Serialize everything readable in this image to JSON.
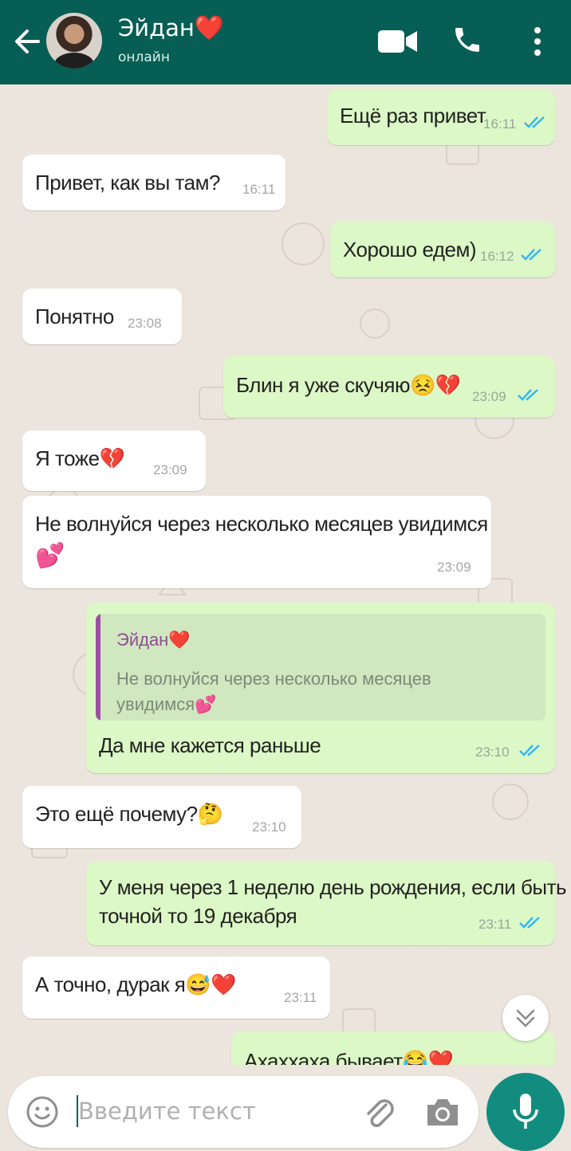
{
  "header": {
    "contact_name": "Эйдан",
    "contact_heart": "❤️",
    "status": "онлайн",
    "back_icon": "arrow-left-icon",
    "video_icon": "video-camera-icon",
    "call_icon": "phone-icon",
    "menu_icon": "more-vert-icon"
  },
  "messages": [
    {
      "dir": "out",
      "text": "Ещё раз привет",
      "time": "16:11",
      "read": true
    },
    {
      "dir": "in",
      "text": "Привет, как вы там?",
      "time": "16:11"
    },
    {
      "dir": "out",
      "text": "Хорошо едем)",
      "time": "16:12",
      "read": true
    },
    {
      "dir": "in",
      "text": "Понятно",
      "time": "23:08"
    },
    {
      "dir": "out",
      "text": "Блин я уже скучяю😣💔",
      "time": "23:09",
      "read": true
    },
    {
      "dir": "in",
      "text": "Я тоже💔",
      "time": "23:09"
    },
    {
      "dir": "in",
      "text": "Не волнуйся через несколько месяцев увидимся",
      "text2": "💕",
      "time": "23:09"
    },
    {
      "dir": "out",
      "reply_author": "Эйдан❤️",
      "reply_text": "Не волнуйся через несколько месяцев увидимся💕",
      "text": "Да мне кажется раньше",
      "time": "23:10",
      "read": true
    },
    {
      "dir": "in",
      "text": "Это ещё почему?🤔",
      "time": "23:10"
    },
    {
      "dir": "out",
      "text": "У меня через 1 неделю день рождения, если быть",
      "text2": "точной то 19 декабря",
      "time": "23:11",
      "read": true
    },
    {
      "dir": "in",
      "text": "А точно, дурак я😅❤️",
      "time": "23:11"
    },
    {
      "dir": "out",
      "text": "Ахаххаха бывает😂❤️",
      "time": ""
    }
  ],
  "composer": {
    "placeholder": "Введите текст",
    "emoji_icon": "emoji-smile-icon",
    "attach_icon": "paperclip-icon",
    "camera_icon": "camera-icon",
    "mic_icon": "microphone-icon",
    "scroll_icon": "chevron-double-down-icon"
  },
  "colors": {
    "header": "#075e54",
    "outgoing_bubble": "#dcf8c6",
    "incoming_bubble": "#ffffff",
    "read_ticks": "#34b7f1",
    "mic_button": "#128c7e",
    "wallpaper": "#ece5dd"
  }
}
